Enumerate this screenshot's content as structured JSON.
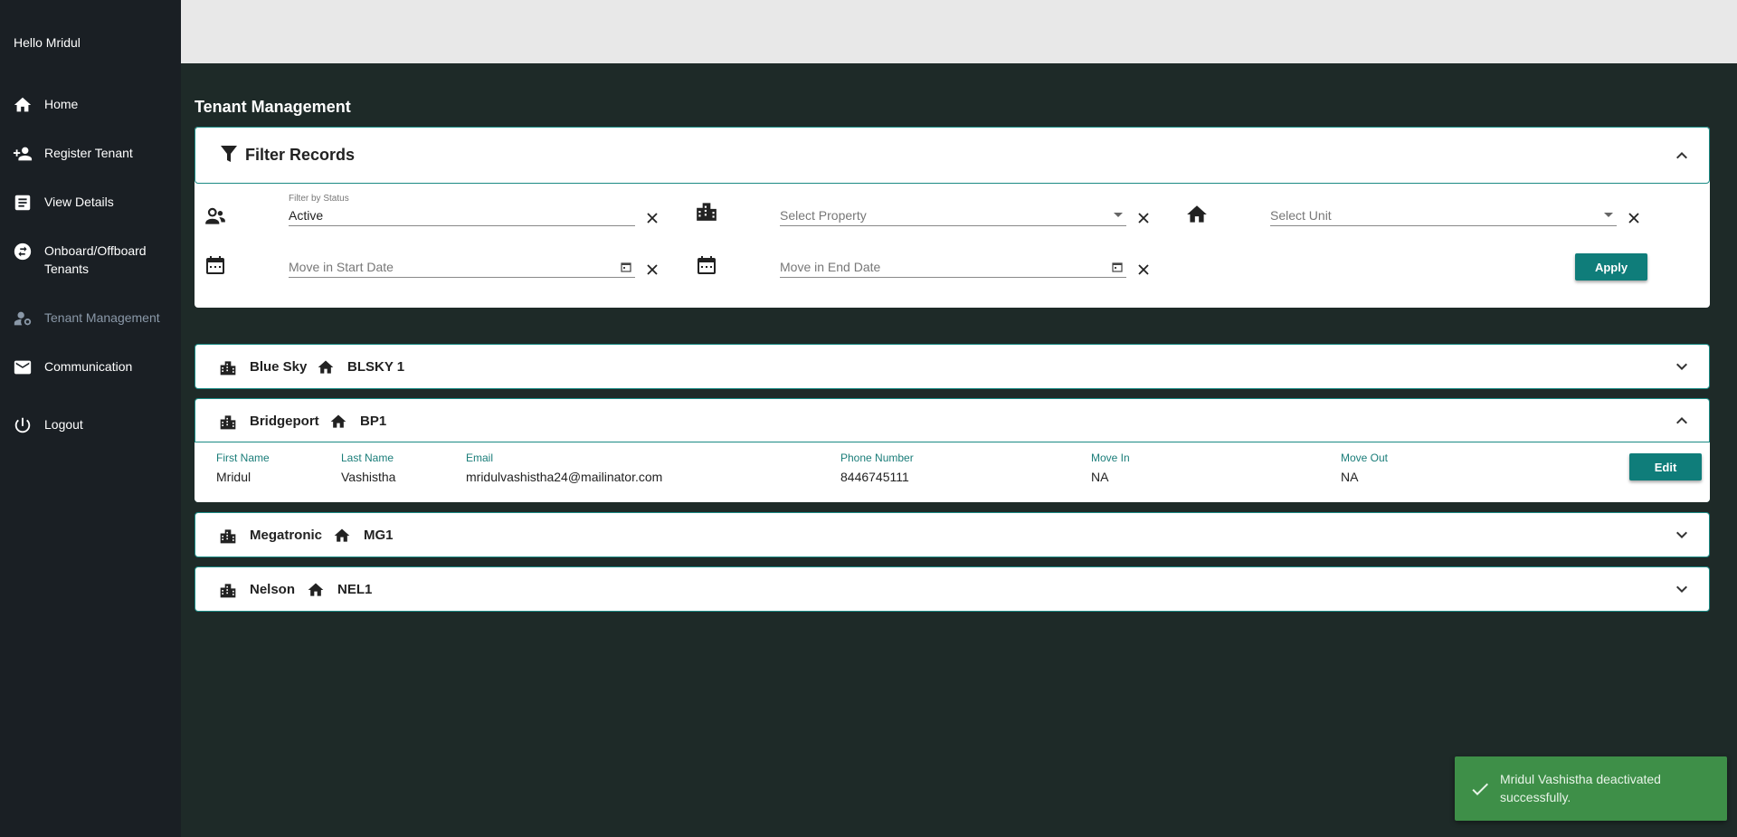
{
  "sidebar": {
    "greeting": "Hello  Mridul",
    "items": [
      {
        "label": "Home",
        "icon": "home-icon"
      },
      {
        "label": "Register Tenant",
        "icon": "person-add-icon"
      },
      {
        "label": "View Details",
        "icon": "article-icon"
      },
      {
        "label": "Onboard/Offboard Tenants",
        "icon": "swap-icon"
      },
      {
        "label": "Tenant Management",
        "icon": "manage-accounts-icon",
        "active": true
      },
      {
        "label": "Communication",
        "icon": "mail-icon"
      },
      {
        "label": "Logout",
        "icon": "power-icon"
      }
    ]
  },
  "page": {
    "title": "Tenant Management"
  },
  "filter": {
    "title": "Filter Records",
    "status_label": "Filter by Status",
    "status_value": "Active",
    "property_placeholder": "Select Property",
    "unit_placeholder": "Select Unit",
    "start_date_placeholder": "Move in Start Date",
    "end_date_placeholder": "Move in End Date",
    "apply_label": "Apply"
  },
  "groups": [
    {
      "property": "Blue Sky",
      "unit": "BLSKY 1",
      "expanded": false
    },
    {
      "property": "Bridgeport",
      "unit": "BP1",
      "expanded": true
    },
    {
      "property": "Megatronic",
      "unit": "MG1",
      "expanded": false
    },
    {
      "property": "Nelson",
      "unit": "NEL1",
      "expanded": false
    }
  ],
  "tenant_table": {
    "headers": [
      "First Name",
      "Last Name",
      "Email",
      "Phone Number",
      "Move In",
      "Move Out"
    ],
    "row": {
      "first_name": "Mridul",
      "last_name": "Vashistha",
      "email": "mridulvashistha24@mailinator.com",
      "phone": "8446745111",
      "move_in": "NA",
      "move_out": "NA"
    },
    "edit_label": "Edit"
  },
  "toast": {
    "message": "Mridul Vashistha deactivated successfully."
  },
  "colors": {
    "accent": "#0f7d7a",
    "sidebar_bg": "#1a1f24",
    "page_bg": "#1e2a28",
    "toast_bg": "#3e8f48"
  }
}
